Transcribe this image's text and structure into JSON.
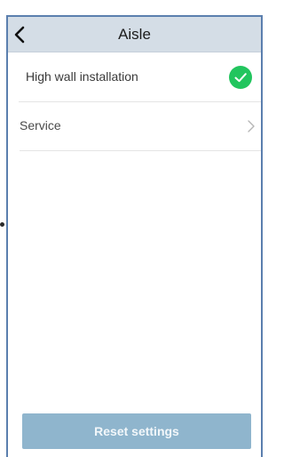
{
  "header": {
    "title": "Aisle",
    "back_icon": "chevron-left-icon"
  },
  "settings": [
    {
      "label": "High wall installation",
      "icon": "check-circle-icon",
      "status": "enabled",
      "accent": "#22c55e"
    },
    {
      "label": "Service",
      "icon": "chevron-right-icon"
    }
  ],
  "footer": {
    "reset_label": "Reset settings",
    "button_color": "#8fb5cd"
  },
  "colors": {
    "header_bg": "#d4dde6",
    "frame_border": "#5b7fae"
  }
}
